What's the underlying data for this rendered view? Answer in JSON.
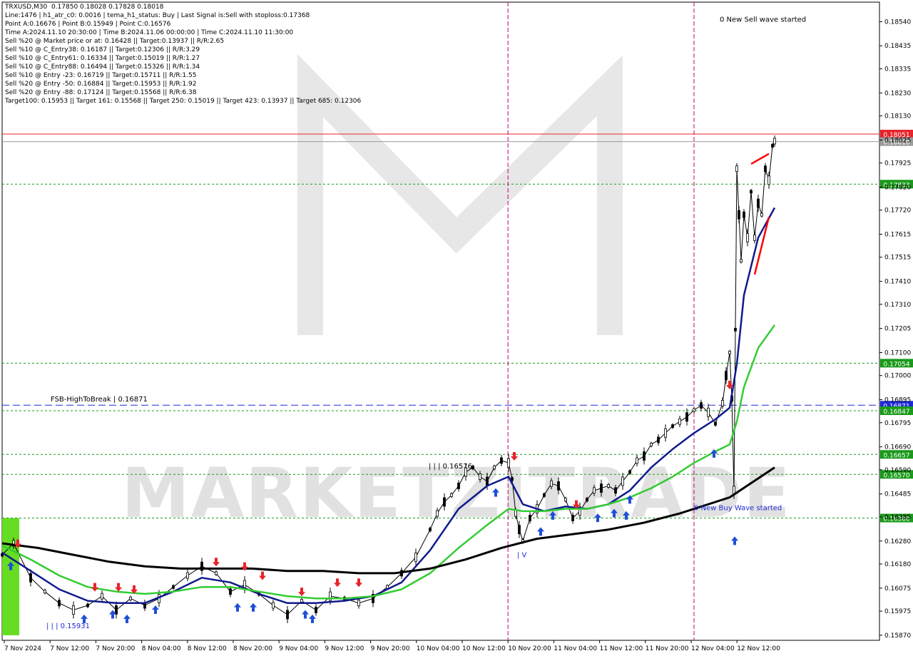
{
  "info_lines": [
    "TRXUSD,M30  0.17850 0.18028 0.17828 0.18018",
    "Line:1476 | h1_atr_c0: 0.0016 | tema_h1_status: Buy | Last Signal is:Sell with stoploss:0.17368",
    "Point A:0.16676 | Point B:0.15949 | Point C:0.16576",
    "Time A:2024.11.10 20:30:00 | Time B:2024.11.06 00:00:00 | Time C:2024.11.10 11:30:00",
    "Sell %20 @ Market price or at: 0.16428 || Target:0.13937 || R/R:2.65",
    "Sell %10 @ C_Entry38: 0.16187 || Target:0.12306 || R/R:3.29",
    "Sell %10 @ C_Entry61: 0.16334 || Target:0.15019 || R/R:1.27",
    "Sell %10 @ C_Entry88: 0.16494 || Target:0.15326 || R/R:1.34",
    "Sell %10 @ Entry -23: 0.16719 || Target:0.15711 || R/R:1.55",
    "Sell %20 @ Entry -50: 0.16884 || Target:0.15953 || R/R:1.92",
    "Sell %20 @ Entry -88: 0.17124 || Target:0.15568 || R/R:6.38",
    "Target100: 0.15953 || Target 161: 0.15568 || Target 250: 0.15019 || Target 423: 0.13937 || Target 685: 0.12306"
  ],
  "chart_data": {
    "type": "line",
    "symbol": "TRXUSD,M30",
    "ohlc": {
      "open": 0.1785,
      "high": 0.18028,
      "low": 0.17828,
      "close": 0.18018
    },
    "ylim": [
      0.15848,
      0.18625
    ],
    "y_ticks": [
      "0.18540",
      "0.18435",
      "0.18335",
      "0.18230",
      "0.18130",
      "0.18025",
      "0.17925",
      "0.17820",
      "0.17720",
      "0.17615",
      "0.17515",
      "0.17410",
      "0.17310",
      "0.17205",
      "0.17100",
      "0.17000",
      "0.16895",
      "0.16795",
      "0.16690",
      "0.16590",
      "0.16485",
      "0.16385",
      "0.16280",
      "0.16180",
      "0.16075",
      "0.15975",
      "0.15870"
    ],
    "x_ticks": [
      "7 Nov 2024",
      "7 Nov 12:00",
      "7 Nov 20:00",
      "8 Nov 04:00",
      "8 Nov 12:00",
      "8 Nov 20:00",
      "9 Nov 04:00",
      "9 Nov 12:00",
      "9 Nov 20:00",
      "10 Nov 04:00",
      "10 Nov 12:00",
      "10 Nov 20:00",
      "11 Nov 04:00",
      "11 Nov 12:00",
      "11 Nov 20:00",
      "12 Nov 04:00",
      "12 Nov 12:00"
    ],
    "horizontal_levels": [
      {
        "value": 0.18051,
        "label": "0.18051",
        "color": "#e8232a",
        "style": "solid"
      },
      {
        "value": 0.18018,
        "label": "0.18018",
        "color": "#9a9a9a",
        "style": "solid"
      },
      {
        "value": 0.17833,
        "label": "0.17833",
        "color": "#1a9a1a",
        "style": "dotted"
      },
      {
        "value": 0.17054,
        "label": "0.17054",
        "color": "#1a9a1a",
        "style": "dotted"
      },
      {
        "value": 0.16871,
        "label": "0.16871",
        "color": "#1f2ad8",
        "style": "dashed"
      },
      {
        "value": 0.16847,
        "label": "0.16847",
        "color": "#1a9a1a",
        "style": "dotted"
      },
      {
        "value": 0.16657,
        "label": "0.16657",
        "color": "#1a9a1a",
        "style": "dotted"
      },
      {
        "value": 0.1657,
        "label": "0.16570",
        "color": "#1a9a1a",
        "style": "dotted"
      },
      {
        "value": 0.1638,
        "label": "0.16380",
        "color": "#1a9a1a",
        "style": "dotted"
      }
    ],
    "vertical_markers": [
      "10 Nov 20:00",
      "12 Nov 04:00"
    ],
    "annotations": [
      {
        "text": "0 New Sell wave started",
        "x_idx": 1006,
        "value": 0.1854,
        "color": "#000000"
      },
      {
        "text": "0 New Buy Wave started",
        "x_idx": 970,
        "value": 0.16415,
        "color": "#1f2ad8"
      },
      {
        "text": "FSB-HighToBreak | 0.16871",
        "x_idx": 68,
        "value": 0.16888,
        "color": "#000000"
      },
      {
        "text": "| | | 0.15931",
        "x_idx": 62,
        "value": 0.159,
        "color": "#1f2ad8"
      },
      {
        "text": "| | | 0.16576",
        "x_idx": 598,
        "value": 0.16595,
        "color": "#000000"
      },
      {
        "text": "| V",
        "x_idx": 722,
        "value": 0.1621,
        "color": "#1f2ad8"
      }
    ],
    "series": [
      {
        "name": "",
        "color": "#000000",
        "style": "candles",
        "x": [
          0,
          16,
          40,
          60,
          80,
          100,
          120,
          140,
          160,
          180,
          200,
          220,
          240,
          260,
          280,
          300,
          320,
          340,
          360,
          380,
          400,
          420,
          440,
          460,
          480,
          500,
          520,
          540,
          560,
          580,
          600,
          610,
          620,
          630,
          640,
          650,
          660,
          670,
          680,
          690,
          700,
          710,
          715,
          720,
          725,
          730,
          740,
          750,
          760,
          770,
          780,
          790,
          800,
          810,
          820,
          830,
          840,
          850,
          860,
          870,
          880,
          890,
          900,
          910,
          920,
          930,
          940,
          950,
          960,
          970,
          980,
          990,
          1000,
          1010,
          1015,
          1020,
          1023,
          1026,
          1028,
          1030,
          1033,
          1036,
          1040,
          1045,
          1050,
          1055,
          1060,
          1065,
          1070,
          1075,
          1080,
          1083
        ],
        "values": [
          0.1622,
          0.1627,
          0.1612,
          0.1606,
          0.1601,
          0.1598,
          0.16,
          0.1604,
          0.1598,
          0.1603,
          0.16,
          0.1603,
          0.1608,
          0.1613,
          0.1617,
          0.1614,
          0.1606,
          0.1609,
          0.1605,
          0.16,
          0.1596,
          0.1602,
          0.1598,
          0.1604,
          0.1603,
          0.1601,
          0.1603,
          0.1608,
          0.1614,
          0.1621,
          0.1633,
          0.164,
          0.1645,
          0.1648,
          0.1652,
          0.1658,
          0.166,
          0.1656,
          0.1654,
          0.166,
          0.1663,
          0.1662,
          0.1655,
          0.164,
          0.1633,
          0.1628,
          0.1638,
          0.1642,
          0.1648,
          0.1653,
          0.1652,
          0.1646,
          0.1638,
          0.1641,
          0.1646,
          0.165,
          0.1651,
          0.1652,
          0.165,
          0.1654,
          0.1658,
          0.1663,
          0.1665,
          0.167,
          0.1672,
          0.1675,
          0.1678,
          0.168,
          0.1682,
          0.1685,
          0.1687,
          0.1684,
          0.1679,
          0.1688,
          0.17,
          0.171,
          0.169,
          0.165,
          0.172,
          0.179,
          0.177,
          0.175,
          0.177,
          0.176,
          0.178,
          0.176,
          0.1775,
          0.177,
          0.179,
          0.1785,
          0.18,
          0.1802
        ]
      },
      {
        "name": "",
        "color": "#0f1a8c",
        "style": "line",
        "x": [
          0,
          40,
          80,
          120,
          160,
          200,
          240,
          280,
          320,
          360,
          400,
          440,
          480,
          520,
          560,
          600,
          640,
          680,
          710,
          730,
          760,
          790,
          820,
          850,
          880,
          910,
          940,
          970,
          1000,
          1020,
          1030,
          1040,
          1060,
          1083
        ],
        "values": [
          0.1623,
          0.1615,
          0.1607,
          0.1602,
          0.1601,
          0.1601,
          0.1606,
          0.1612,
          0.161,
          0.1605,
          0.1601,
          0.1601,
          0.1602,
          0.1604,
          0.161,
          0.1624,
          0.1642,
          0.1652,
          0.1656,
          0.1644,
          0.1641,
          0.1643,
          0.1642,
          0.1644,
          0.165,
          0.166,
          0.1668,
          0.1675,
          0.1681,
          0.1686,
          0.1705,
          0.1735,
          0.176,
          0.1773
        ]
      },
      {
        "name": "",
        "color": "#33cc33",
        "style": "line",
        "x": [
          0,
          40,
          80,
          120,
          160,
          200,
          240,
          280,
          320,
          360,
          400,
          440,
          480,
          520,
          560,
          600,
          640,
          680,
          710,
          730,
          760,
          790,
          820,
          850,
          880,
          910,
          940,
          970,
          1000,
          1020,
          1030,
          1040,
          1060,
          1083
        ],
        "values": [
          0.1626,
          0.162,
          0.1613,
          0.1608,
          0.1606,
          0.1605,
          0.1606,
          0.1608,
          0.1608,
          0.1606,
          0.1604,
          0.1603,
          0.1603,
          0.1604,
          0.1607,
          0.1614,
          0.1625,
          0.1635,
          0.1642,
          0.1641,
          0.1641,
          0.1642,
          0.1642,
          0.1644,
          0.1647,
          0.1651,
          0.1656,
          0.1662,
          0.1667,
          0.167,
          0.168,
          0.1695,
          0.1712,
          0.1722
        ]
      },
      {
        "name": "",
        "color": "#000000",
        "style": "line",
        "x": [
          0,
          50,
          100,
          150,
          200,
          250,
          300,
          350,
          400,
          450,
          500,
          550,
          600,
          650,
          700,
          750,
          800,
          850,
          900,
          950,
          1000,
          1020,
          1083
        ],
        "values": [
          0.1627,
          0.1625,
          0.1622,
          0.1619,
          0.1617,
          0.1616,
          0.1616,
          0.1616,
          0.1615,
          0.1615,
          0.1614,
          0.1614,
          0.1616,
          0.162,
          0.1625,
          0.1629,
          0.1631,
          0.1633,
          0.1636,
          0.164,
          0.1645,
          0.1647,
          0.166
        ]
      },
      {
        "name": "",
        "color": "#ff0000",
        "style": "line",
        "x": [
          1050,
          1075
        ],
        "values": [
          0.17921,
          0.17965
        ]
      },
      {
        "name": "",
        "color": "#ff0000",
        "style": "line",
        "x": [
          1055,
          1075
        ],
        "values": [
          0.1744,
          0.1769
        ]
      }
    ],
    "signals": [
      {
        "dir": "buy",
        "x_idx": 12,
        "value": 0.1619
      },
      {
        "dir": "sell",
        "x_idx": 22,
        "value": 0.1625
      },
      {
        "dir": "buy",
        "x_idx": 115,
        "value": 0.1596
      },
      {
        "dir": "sell",
        "x_idx": 130,
        "value": 0.1606
      },
      {
        "dir": "buy",
        "x_idx": 155,
        "value": 0.1598
      },
      {
        "dir": "sell",
        "x_idx": 163,
        "value": 0.1606
      },
      {
        "dir": "buy",
        "x_idx": 175,
        "value": 0.1596
      },
      {
        "dir": "sell",
        "x_idx": 185,
        "value": 0.1605
      },
      {
        "dir": "buy",
        "x_idx": 215,
        "value": 0.16
      },
      {
        "dir": "sell",
        "x_idx": 300,
        "value": 0.1617
      },
      {
        "dir": "sell",
        "x_idx": 340,
        "value": 0.1615
      },
      {
        "dir": "buy",
        "x_idx": 330,
        "value": 0.1601
      },
      {
        "dir": "buy",
        "x_idx": 352,
        "value": 0.1601
      },
      {
        "dir": "sell",
        "x_idx": 365,
        "value": 0.1611
      },
      {
        "dir": "sell",
        "x_idx": 420,
        "value": 0.1604
      },
      {
        "dir": "buy",
        "x_idx": 425,
        "value": 0.1598
      },
      {
        "dir": "buy",
        "x_idx": 435,
        "value": 0.1596
      },
      {
        "dir": "sell",
        "x_idx": 470,
        "value": 0.1608
      },
      {
        "dir": "sell",
        "x_idx": 500,
        "value": 0.1608
      },
      {
        "dir": "buy",
        "x_idx": 692,
        "value": 0.1651
      },
      {
        "dir": "sell",
        "x_idx": 718,
        "value": 0.1663
      },
      {
        "dir": "buy",
        "x_idx": 755,
        "value": 0.1634
      },
      {
        "dir": "buy",
        "x_idx": 772,
        "value": 0.1641
      },
      {
        "dir": "sell",
        "x_idx": 805,
        "value": 0.1642
      },
      {
        "dir": "buy",
        "x_idx": 835,
        "value": 0.164
      },
      {
        "dir": "buy",
        "x_idx": 858,
        "value": 0.1642
      },
      {
        "dir": "buy",
        "x_idx": 875,
        "value": 0.1641
      },
      {
        "dir": "buy",
        "x_idx": 880,
        "value": 0.1648
      },
      {
        "dir": "buy",
        "x_idx": 998,
        "value": 0.1668
      },
      {
        "dir": "sell",
        "x_idx": 1020,
        "value": 0.1694
      },
      {
        "dir": "buy",
        "x_idx": 1027,
        "value": 0.163
      }
    ],
    "watermark": "MARKETZITRADE",
    "grid": false
  }
}
